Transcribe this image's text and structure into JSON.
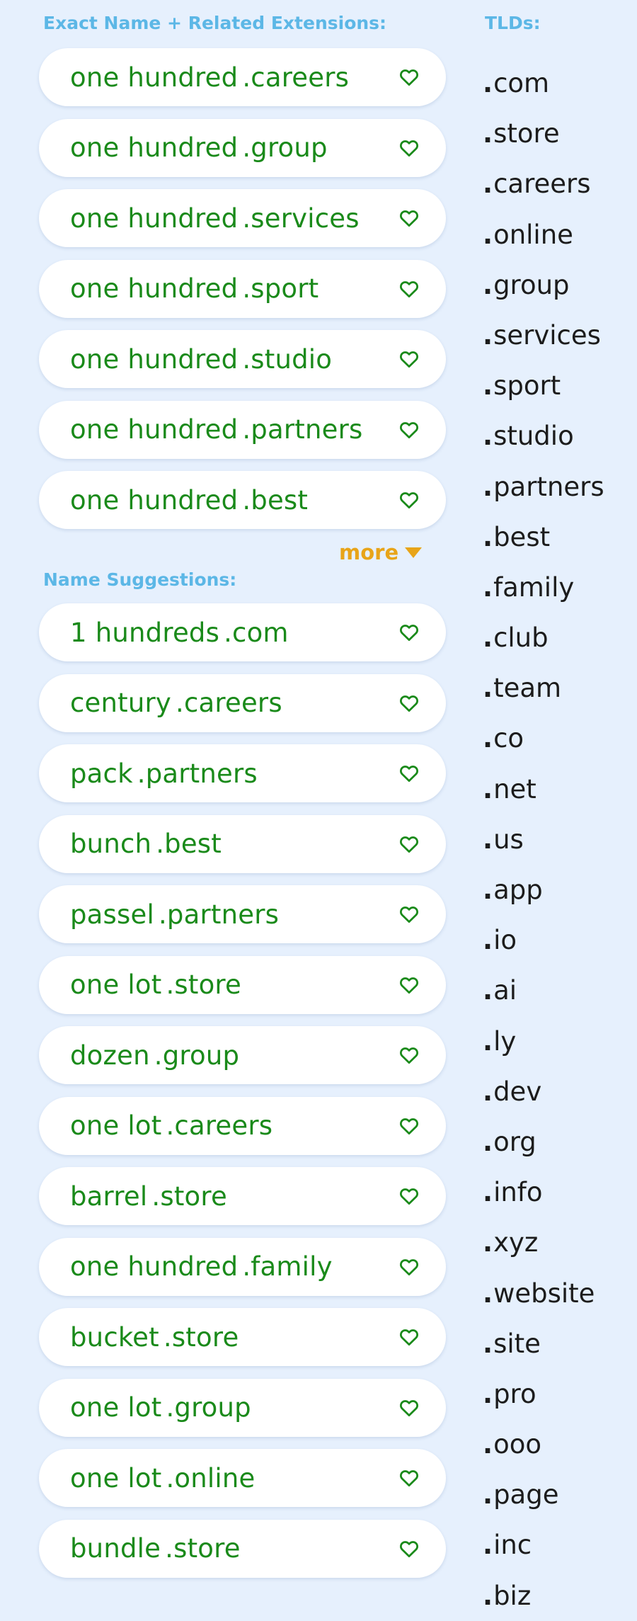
{
  "sections": {
    "exact_title": "Exact Name + Related Extensions:",
    "suggestions_title": "Name Suggestions:",
    "tlds_title": "TLDs:"
  },
  "more_label": "more",
  "exact": [
    {
      "name": "one hundred",
      "ext": ".careers"
    },
    {
      "name": "one hundred",
      "ext": ".group"
    },
    {
      "name": "one hundred",
      "ext": ".services"
    },
    {
      "name": "one hundred",
      "ext": ".sport"
    },
    {
      "name": "one hundred",
      "ext": ".studio"
    },
    {
      "name": "one hundred",
      "ext": ".partners"
    },
    {
      "name": "one hundred",
      "ext": ".best"
    }
  ],
  "suggestions": [
    {
      "name": "1 hundreds",
      "ext": ".com"
    },
    {
      "name": "century",
      "ext": ".careers"
    },
    {
      "name": "pack",
      "ext": ".partners"
    },
    {
      "name": "bunch",
      "ext": ".best"
    },
    {
      "name": "passel",
      "ext": ".partners"
    },
    {
      "name": "one lot",
      "ext": ".store"
    },
    {
      "name": "dozen",
      "ext": ".group"
    },
    {
      "name": "one lot",
      "ext": ".careers"
    },
    {
      "name": "barrel",
      "ext": ".store"
    },
    {
      "name": "one hundred",
      "ext": ".family"
    },
    {
      "name": "bucket",
      "ext": ".store"
    },
    {
      "name": "one lot",
      "ext": ".group"
    },
    {
      "name": "one lot",
      "ext": ".online"
    },
    {
      "name": "bundle",
      "ext": ".store"
    }
  ],
  "tlds": [
    "com",
    "store",
    "careers",
    "online",
    "group",
    "services",
    "sport",
    "studio",
    "partners",
    "best",
    "family",
    "club",
    "team",
    "co",
    "net",
    "us",
    "app",
    "io",
    "ai",
    "ly",
    "dev",
    "org",
    "info",
    "xyz",
    "website",
    "site",
    "pro",
    "ooo",
    "page",
    "inc",
    "biz"
  ],
  "colors": {
    "background": "#e6f0fd",
    "domain_text": "#1a8a1a",
    "section_title": "#5cb7e6",
    "more": "#e8a418"
  },
  "icons": {
    "favorite": "heart-outline-icon",
    "more": "caret-down-icon"
  }
}
